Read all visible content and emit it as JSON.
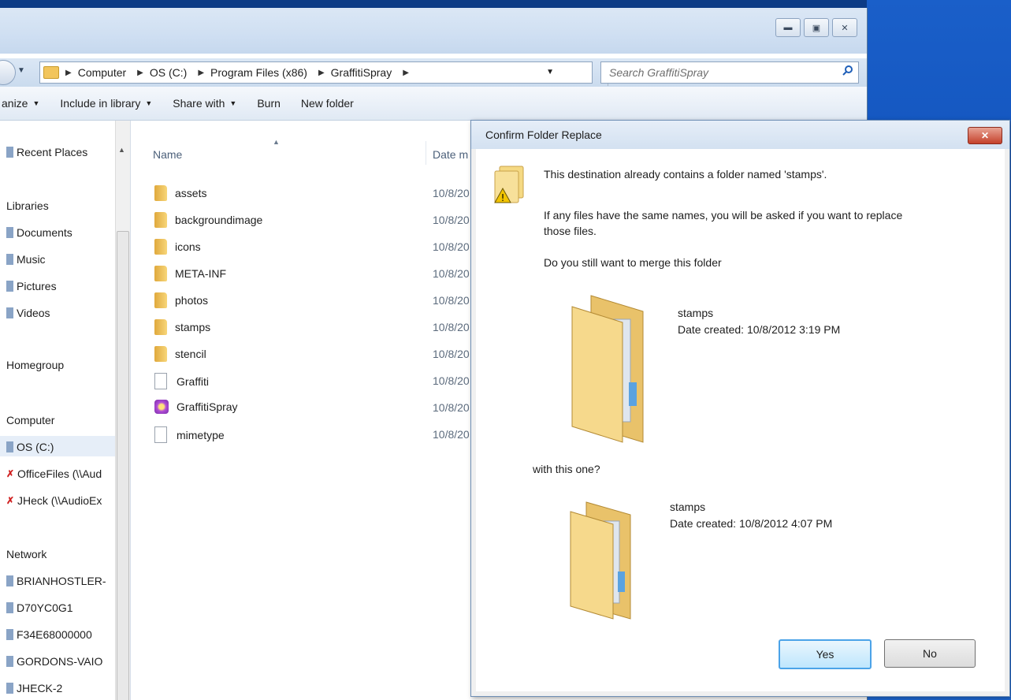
{
  "explorer": {
    "address": {
      "crumbs": [
        "Computer",
        "OS (C:)",
        "Program Files (x86)",
        "GraffitiSpray"
      ]
    },
    "search": {
      "placeholder": "Search GraffitiSpray"
    },
    "toolbar": {
      "organize": "anize",
      "include": "Include in library",
      "share": "Share with",
      "burn": "Burn",
      "new_folder": "New folder"
    },
    "nav": {
      "recent": "Recent Places",
      "libraries": "Libraries",
      "documents": "Documents",
      "music": "Music",
      "pictures": "Pictures",
      "videos": "Videos",
      "homegroup": "Homegroup",
      "computer": "Computer",
      "os": "OS (C:)",
      "officefiles": "OfficeFiles (\\\\Aud",
      "jheck": "JHeck (\\\\AudioEx",
      "network": "Network",
      "net1": "BRIANHOSTLER-",
      "net2": "D70YC0G1",
      "net3": "F34E68000000",
      "net4": "GORDONS-VAIO",
      "net5": "JHECK-2"
    },
    "columns": {
      "name": "Name",
      "date": "Date m"
    },
    "files": [
      {
        "name": "assets",
        "date": "10/8/20",
        "kind": "folder"
      },
      {
        "name": "backgroundimage",
        "date": "10/8/20",
        "kind": "folder"
      },
      {
        "name": "icons",
        "date": "10/8/20",
        "kind": "folder"
      },
      {
        "name": "META-INF",
        "date": "10/8/20",
        "kind": "folder"
      },
      {
        "name": "photos",
        "date": "10/8/20",
        "kind": "folder"
      },
      {
        "name": "stamps",
        "date": "10/8/20",
        "kind": "folder"
      },
      {
        "name": "stencil",
        "date": "10/8/20",
        "kind": "folder"
      },
      {
        "name": "Graffiti",
        "date": "10/8/20",
        "kind": "file"
      },
      {
        "name": "GraffitiSpray",
        "date": "10/8/20",
        "kind": "app"
      },
      {
        "name": "mimetype",
        "date": "10/8/20",
        "kind": "file"
      }
    ]
  },
  "dialog": {
    "title": "Confirm Folder Replace",
    "line1": "This destination already contains a folder named 'stamps'.",
    "line2a": "If any files have the same names, you will be asked if you want to replace",
    "line2b": "those files.",
    "line3": "Do you still want to merge this folder",
    "existing": {
      "name": "stamps",
      "created": "Date created: 10/8/2012 3:19 PM"
    },
    "with_text": "with this one?",
    "incoming": {
      "name": "stamps",
      "created": "Date created: 10/8/2012 4:07 PM"
    },
    "yes": "Yes",
    "no": "No"
  },
  "colors": {
    "accent": "#4ba3e8",
    "close": "#c4412b",
    "folder": "#f2c55c"
  }
}
